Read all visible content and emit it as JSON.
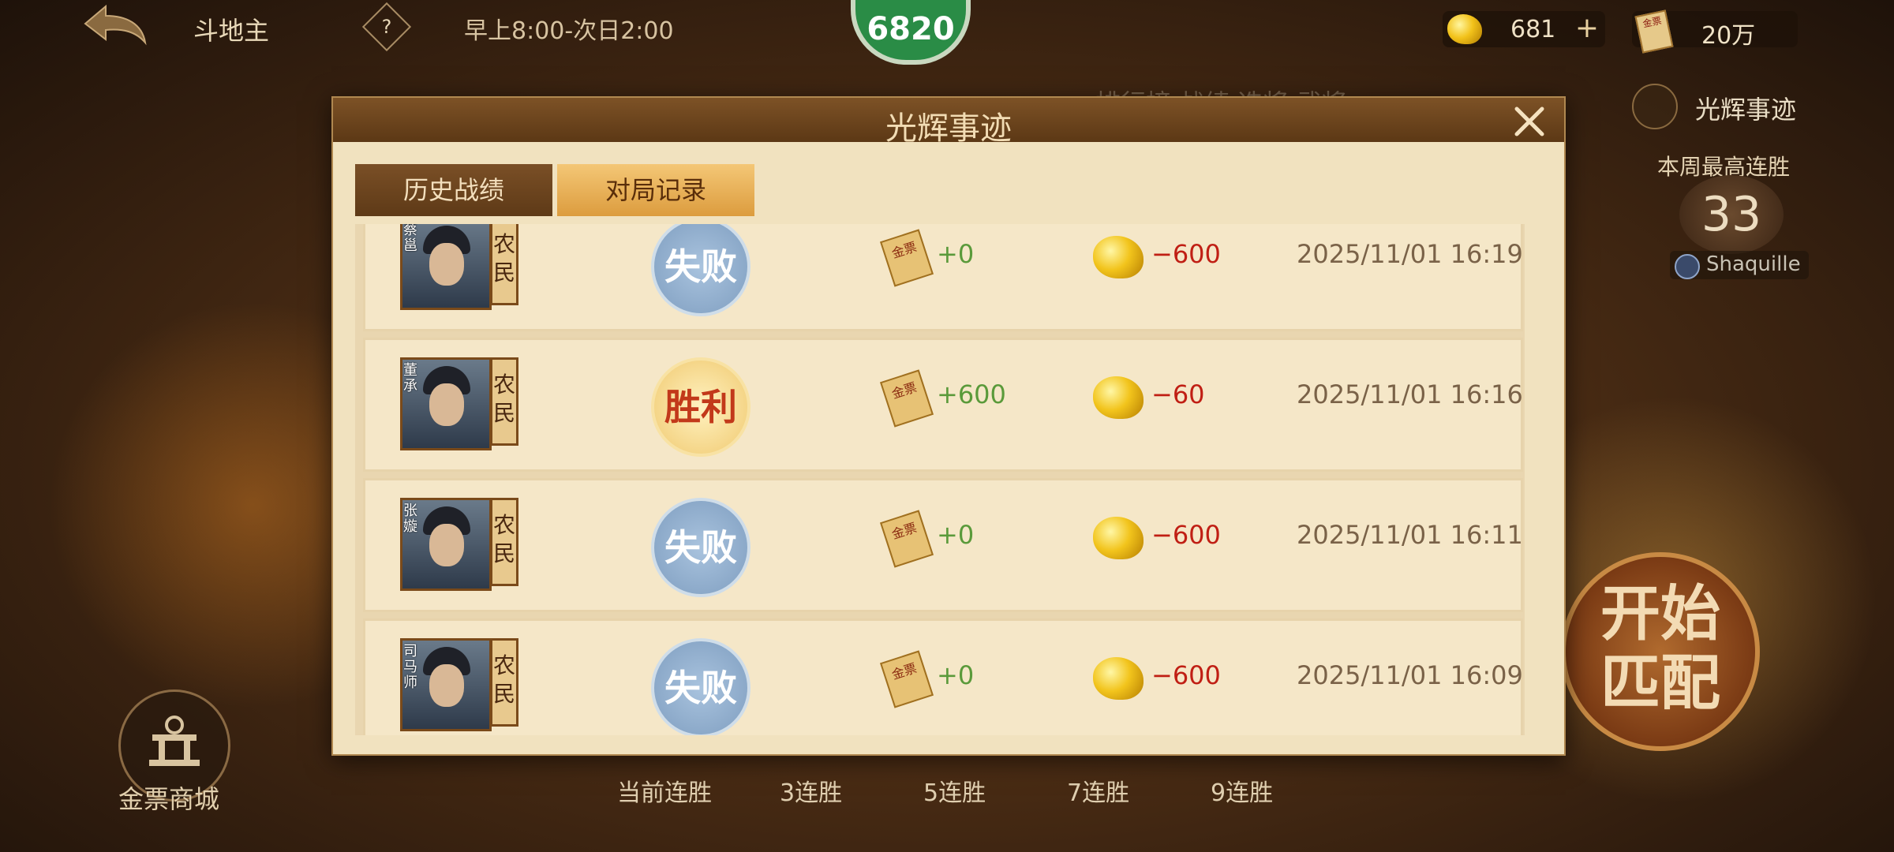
{
  "topbar": {
    "game_title": "斗地主",
    "help_label": "?",
    "hours": "早上8:00-次日2:00",
    "center_badge": "6820",
    "bean_count": "681",
    "plus_label": "+",
    "ticket_count": "20万",
    "ticket_icon_text": "金票"
  },
  "side": {
    "hidden_tabs": "排行榜   战绩   选将 武将",
    "glory_tab": "光辉事迹",
    "week_best_label": "本周最高连胜",
    "week_best_value": "33",
    "player_name": "Shaquille",
    "start_match": "开始匹配"
  },
  "bottom": {
    "shop_label": "金票商城",
    "streaks": [
      "当前连胜",
      "3连胜",
      "5连胜",
      "7连胜",
      "9连胜"
    ]
  },
  "modal": {
    "title": "光辉事迹",
    "tabs": [
      {
        "label": "历史战绩",
        "active": false
      },
      {
        "label": "对局记录",
        "active": true
      }
    ],
    "records": [
      {
        "hero": "蔡邕",
        "role": "农民",
        "result": "失败",
        "ticket": "+0",
        "beans": "−600",
        "time": "2025/11/01   16:19"
      },
      {
        "hero": "董承",
        "role": "农民",
        "result": "胜利",
        "ticket": "+600",
        "beans": "−60",
        "time": "2025/11/01   16:16"
      },
      {
        "hero": "张嫙",
        "role": "农民",
        "result": "失败",
        "ticket": "+0",
        "beans": "−600",
        "time": "2025/11/01   16:11"
      },
      {
        "hero": "司马师",
        "role": "农民",
        "result": "失败",
        "ticket": "+0",
        "beans": "−600",
        "time": "2025/11/01   16:09"
      }
    ]
  },
  "colors": {
    "modal_bg": "#f1e2bf",
    "header_brown": "#6a4420",
    "gain_green": "#5a9a3a",
    "loss_red": "#c01f14",
    "active_tab": "#e8ac4e"
  }
}
